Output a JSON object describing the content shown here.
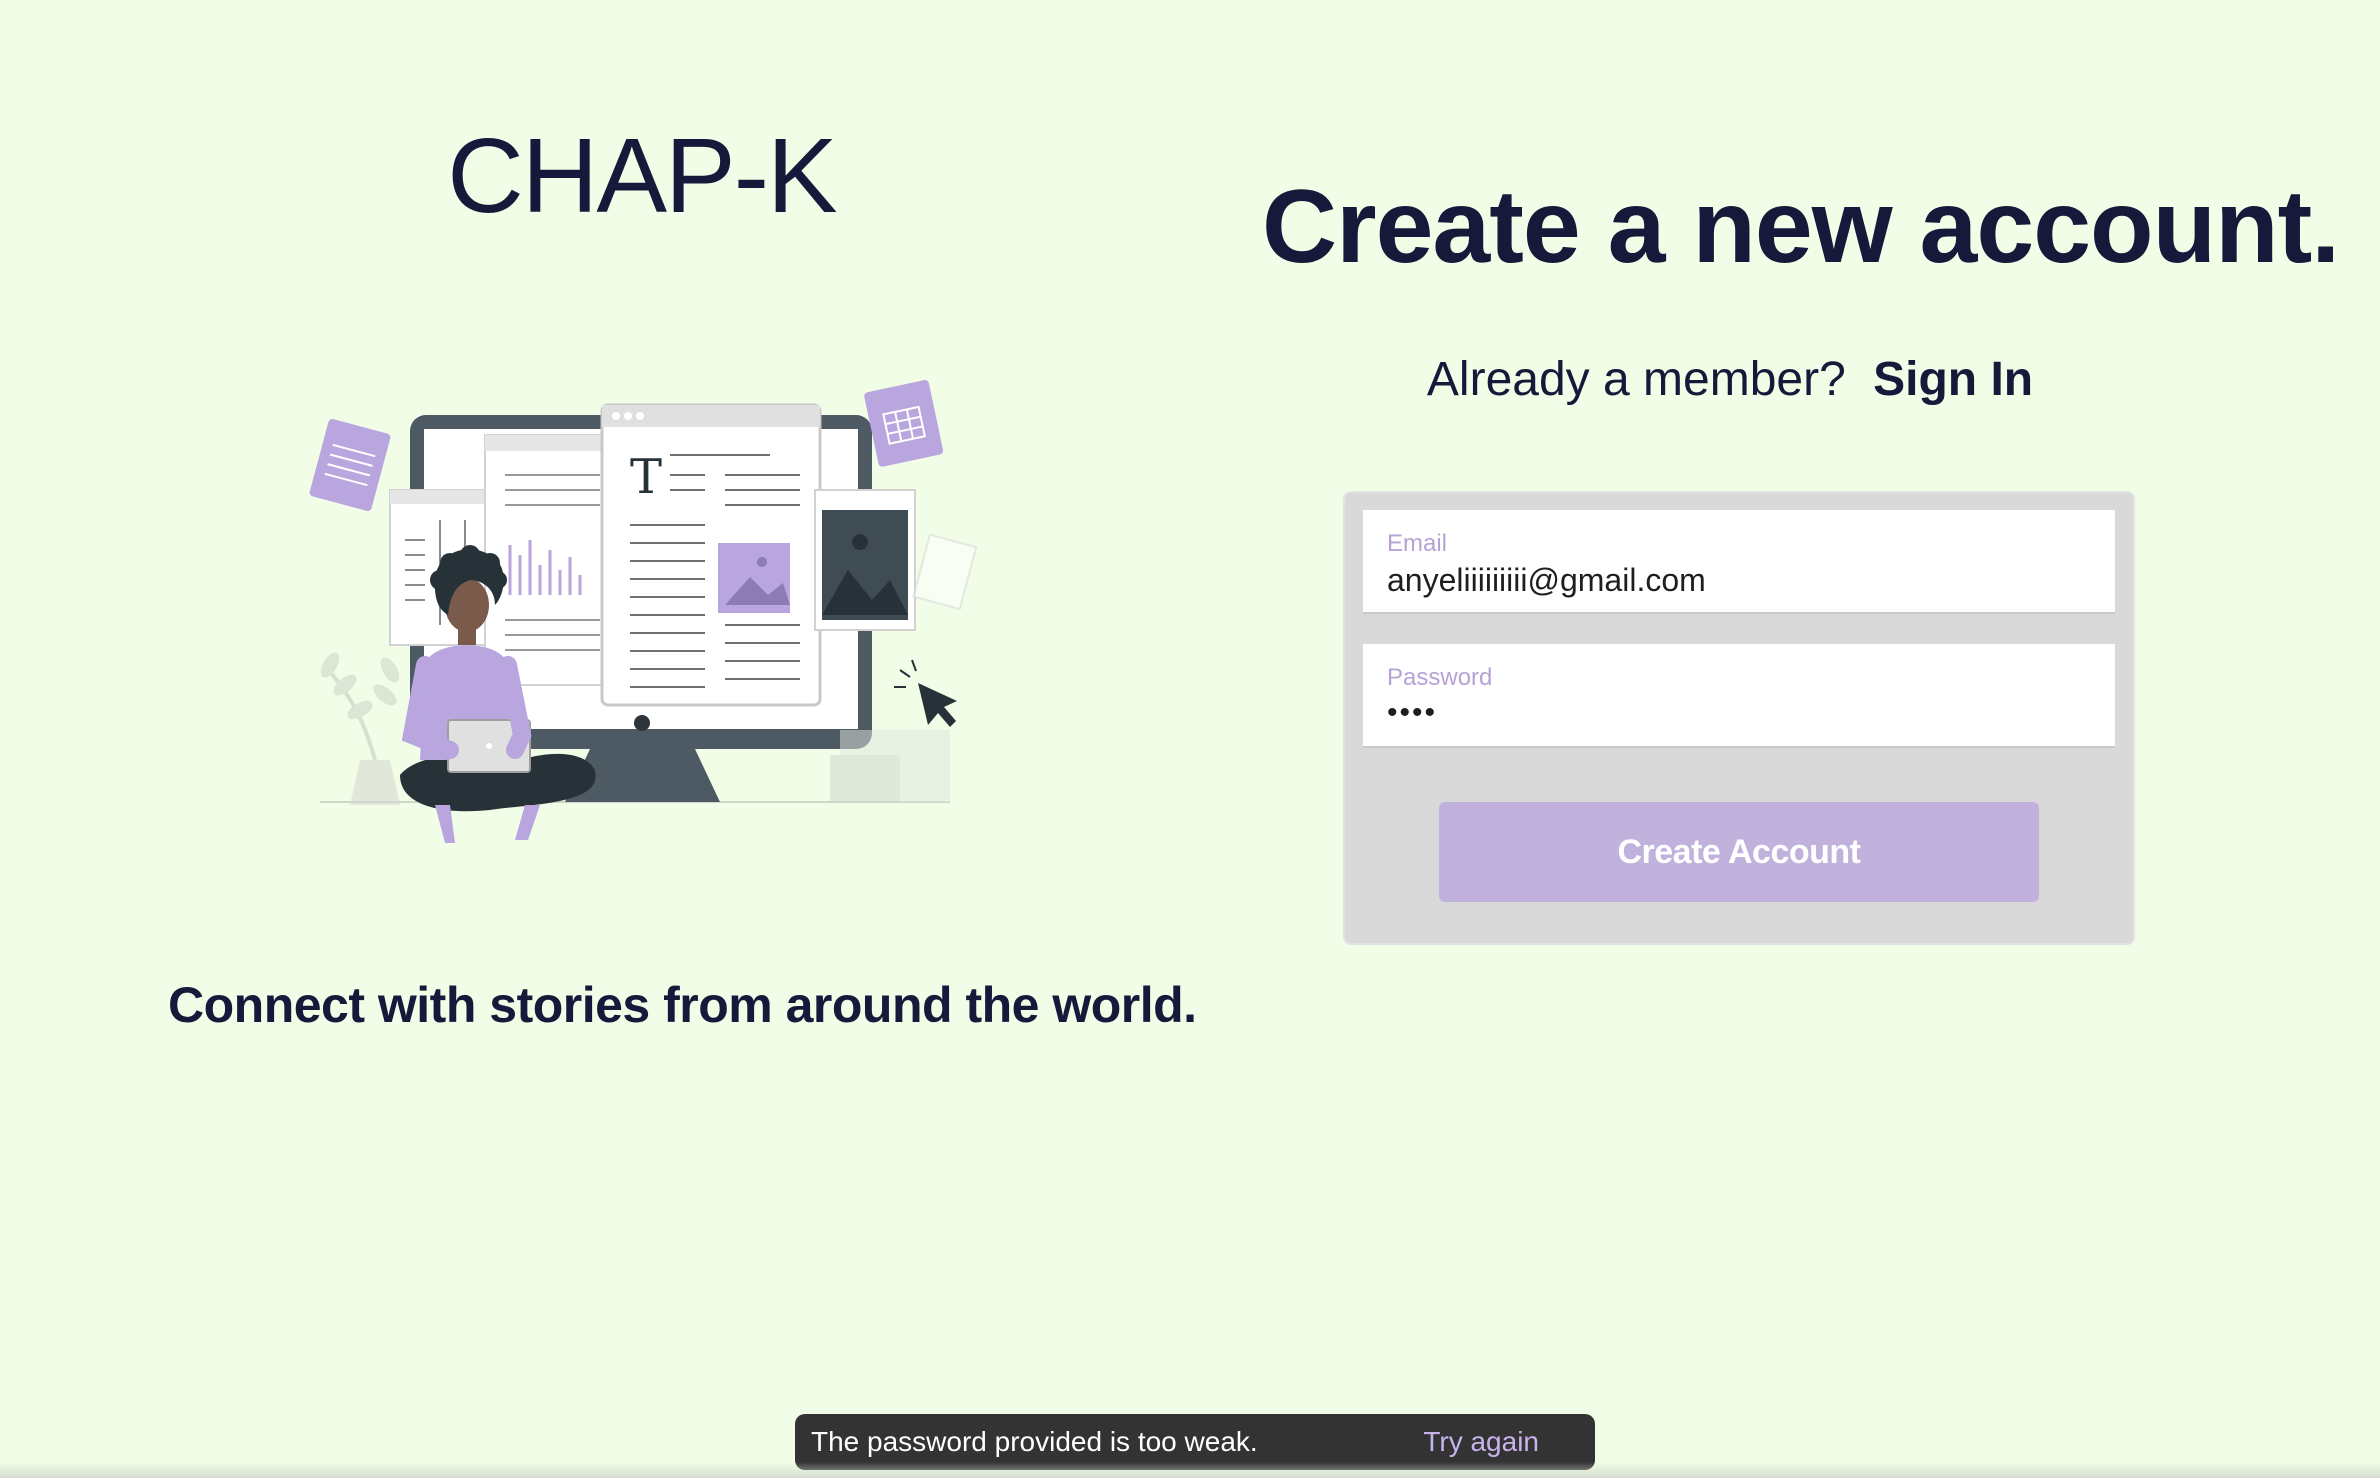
{
  "brand": {
    "name": "CHAP-K"
  },
  "left": {
    "tagline": "Connect with stories from around the world."
  },
  "signup": {
    "heading": "Create a new account.",
    "member_prompt": "Already a member?",
    "signin_link": "Sign In",
    "email": {
      "label": "Email",
      "value": "anyeliiiiiiiii@gmail.com"
    },
    "password": {
      "label": "Password",
      "value": "••••"
    },
    "submit_label": "Create Account"
  },
  "snackbar": {
    "message": "The password provided is too weak.",
    "action": "Try again"
  },
  "colors": {
    "background": "#f1fde6",
    "text": "#17193b",
    "accent": "#c0b2dc",
    "panel": "#d9d9d9",
    "snackbar": "#333333",
    "snackbar_action": "#c6b3ec"
  },
  "icons": {
    "illustration": "person-with-laptop-and-monitor-illustration"
  }
}
